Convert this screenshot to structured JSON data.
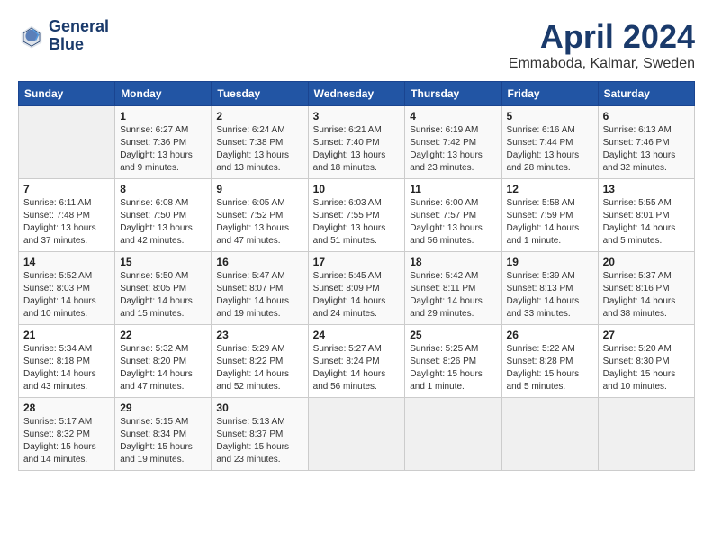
{
  "header": {
    "logo_line1": "General",
    "logo_line2": "Blue",
    "month": "April 2024",
    "location": "Emmaboda, Kalmar, Sweden"
  },
  "days_of_week": [
    "Sunday",
    "Monday",
    "Tuesday",
    "Wednesday",
    "Thursday",
    "Friday",
    "Saturday"
  ],
  "weeks": [
    [
      {
        "day": "",
        "info": ""
      },
      {
        "day": "1",
        "info": "Sunrise: 6:27 AM\nSunset: 7:36 PM\nDaylight: 13 hours\nand 9 minutes."
      },
      {
        "day": "2",
        "info": "Sunrise: 6:24 AM\nSunset: 7:38 PM\nDaylight: 13 hours\nand 13 minutes."
      },
      {
        "day": "3",
        "info": "Sunrise: 6:21 AM\nSunset: 7:40 PM\nDaylight: 13 hours\nand 18 minutes."
      },
      {
        "day": "4",
        "info": "Sunrise: 6:19 AM\nSunset: 7:42 PM\nDaylight: 13 hours\nand 23 minutes."
      },
      {
        "day": "5",
        "info": "Sunrise: 6:16 AM\nSunset: 7:44 PM\nDaylight: 13 hours\nand 28 minutes."
      },
      {
        "day": "6",
        "info": "Sunrise: 6:13 AM\nSunset: 7:46 PM\nDaylight: 13 hours\nand 32 minutes."
      }
    ],
    [
      {
        "day": "7",
        "info": "Sunrise: 6:11 AM\nSunset: 7:48 PM\nDaylight: 13 hours\nand 37 minutes."
      },
      {
        "day": "8",
        "info": "Sunrise: 6:08 AM\nSunset: 7:50 PM\nDaylight: 13 hours\nand 42 minutes."
      },
      {
        "day": "9",
        "info": "Sunrise: 6:05 AM\nSunset: 7:52 PM\nDaylight: 13 hours\nand 47 minutes."
      },
      {
        "day": "10",
        "info": "Sunrise: 6:03 AM\nSunset: 7:55 PM\nDaylight: 13 hours\nand 51 minutes."
      },
      {
        "day": "11",
        "info": "Sunrise: 6:00 AM\nSunset: 7:57 PM\nDaylight: 13 hours\nand 56 minutes."
      },
      {
        "day": "12",
        "info": "Sunrise: 5:58 AM\nSunset: 7:59 PM\nDaylight: 14 hours\nand 1 minute."
      },
      {
        "day": "13",
        "info": "Sunrise: 5:55 AM\nSunset: 8:01 PM\nDaylight: 14 hours\nand 5 minutes."
      }
    ],
    [
      {
        "day": "14",
        "info": "Sunrise: 5:52 AM\nSunset: 8:03 PM\nDaylight: 14 hours\nand 10 minutes."
      },
      {
        "day": "15",
        "info": "Sunrise: 5:50 AM\nSunset: 8:05 PM\nDaylight: 14 hours\nand 15 minutes."
      },
      {
        "day": "16",
        "info": "Sunrise: 5:47 AM\nSunset: 8:07 PM\nDaylight: 14 hours\nand 19 minutes."
      },
      {
        "day": "17",
        "info": "Sunrise: 5:45 AM\nSunset: 8:09 PM\nDaylight: 14 hours\nand 24 minutes."
      },
      {
        "day": "18",
        "info": "Sunrise: 5:42 AM\nSunset: 8:11 PM\nDaylight: 14 hours\nand 29 minutes."
      },
      {
        "day": "19",
        "info": "Sunrise: 5:39 AM\nSunset: 8:13 PM\nDaylight: 14 hours\nand 33 minutes."
      },
      {
        "day": "20",
        "info": "Sunrise: 5:37 AM\nSunset: 8:16 PM\nDaylight: 14 hours\nand 38 minutes."
      }
    ],
    [
      {
        "day": "21",
        "info": "Sunrise: 5:34 AM\nSunset: 8:18 PM\nDaylight: 14 hours\nand 43 minutes."
      },
      {
        "day": "22",
        "info": "Sunrise: 5:32 AM\nSunset: 8:20 PM\nDaylight: 14 hours\nand 47 minutes."
      },
      {
        "day": "23",
        "info": "Sunrise: 5:29 AM\nSunset: 8:22 PM\nDaylight: 14 hours\nand 52 minutes."
      },
      {
        "day": "24",
        "info": "Sunrise: 5:27 AM\nSunset: 8:24 PM\nDaylight: 14 hours\nand 56 minutes."
      },
      {
        "day": "25",
        "info": "Sunrise: 5:25 AM\nSunset: 8:26 PM\nDaylight: 15 hours\nand 1 minute."
      },
      {
        "day": "26",
        "info": "Sunrise: 5:22 AM\nSunset: 8:28 PM\nDaylight: 15 hours\nand 5 minutes."
      },
      {
        "day": "27",
        "info": "Sunrise: 5:20 AM\nSunset: 8:30 PM\nDaylight: 15 hours\nand 10 minutes."
      }
    ],
    [
      {
        "day": "28",
        "info": "Sunrise: 5:17 AM\nSunset: 8:32 PM\nDaylight: 15 hours\nand 14 minutes."
      },
      {
        "day": "29",
        "info": "Sunrise: 5:15 AM\nSunset: 8:34 PM\nDaylight: 15 hours\nand 19 minutes."
      },
      {
        "day": "30",
        "info": "Sunrise: 5:13 AM\nSunset: 8:37 PM\nDaylight: 15 hours\nand 23 minutes."
      },
      {
        "day": "",
        "info": ""
      },
      {
        "day": "",
        "info": ""
      },
      {
        "day": "",
        "info": ""
      },
      {
        "day": "",
        "info": ""
      }
    ]
  ]
}
